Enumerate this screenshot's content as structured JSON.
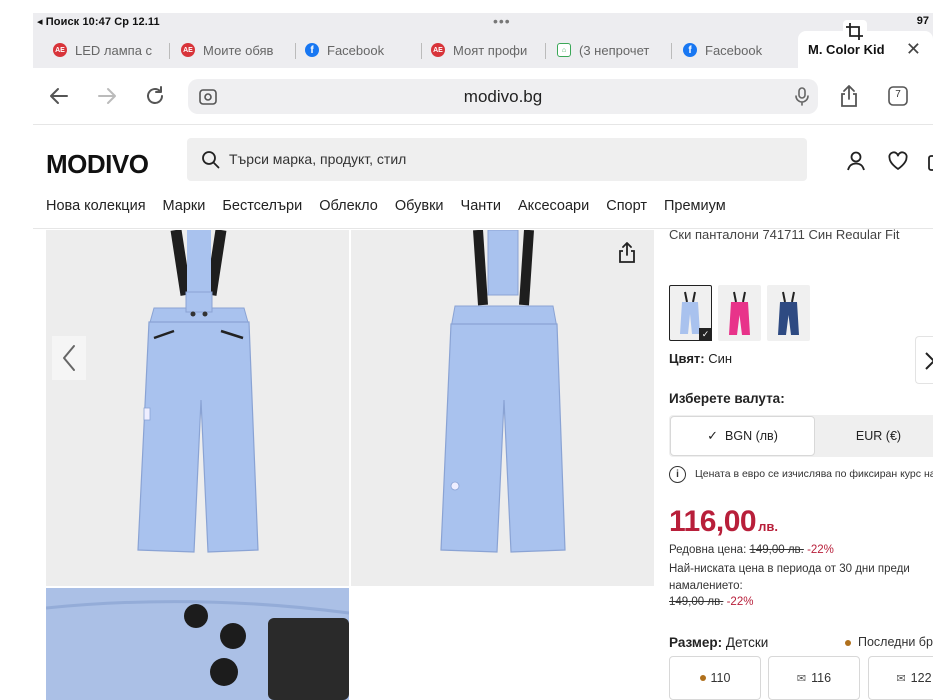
{
  "status_bar": {
    "left": "◂ Поиск  10:47  Ср 12.11",
    "dots": "•••",
    "right": "97"
  },
  "tabs": [
    {
      "label": "LED лампа с",
      "favicon": "aliexpress-icon"
    },
    {
      "label": "Моите обяв",
      "favicon": "aliexpress-icon"
    },
    {
      "label": "Facebook",
      "favicon": "facebook-icon"
    },
    {
      "label": "Моят профи",
      "favicon": "aliexpress-icon"
    },
    {
      "label": "(3 непрочет",
      "favicon": "house-icon"
    },
    {
      "label": "Facebook",
      "favicon": "facebook-icon"
    }
  ],
  "active_tab": {
    "label": "M. Color Kid",
    "close": "✕"
  },
  "address_bar": {
    "url": "modivo.bg"
  },
  "tab_count": "7",
  "site": {
    "logo": "MODIVO",
    "search_placeholder": "Търси марка, продукт, стил",
    "categories": [
      "Нова колекция",
      "Марки",
      "Бестселъри",
      "Облекло",
      "Обувки",
      "Чанти",
      "Аксесоари",
      "Спорт",
      "Премиум"
    ]
  },
  "product": {
    "title": "Ски панталони 741711 Син Regular Fit",
    "color_label": "Цвят:",
    "color_value": "Син",
    "swatch_colors": [
      "#a9c2ee",
      "#e8338a",
      "#2e4a82"
    ],
    "currency_label": "Изберете валута:",
    "currency_options": [
      "BGN (лв)",
      "EUR (€)"
    ],
    "currency_selected": "BGN (лв)",
    "euro_note": "Цената в евро се изчислява по фиксиран курс на",
    "price": "116,00",
    "price_currency": "лв.",
    "regular_label": "Редовна цена:",
    "regular_price": "149,00 лв.",
    "regular_discount": "-22%",
    "lowest_label": "Най-ниската цена в периода от 30 дни преди намалението:",
    "lowest_price": "149,00 лв.",
    "lowest_discount": "-22%",
    "size_label": "Размер:",
    "size_value": "Детски",
    "last_sizes": "Последни бр",
    "sizes": [
      {
        "label": "110",
        "marker": "dot"
      },
      {
        "label": "116",
        "marker": "envelope"
      },
      {
        "label": "122",
        "marker": "envelope"
      }
    ]
  },
  "colors": {
    "accent_price": "#b81f3a",
    "pants": "#a9c2ee",
    "gallery_bg": "#ededed"
  }
}
